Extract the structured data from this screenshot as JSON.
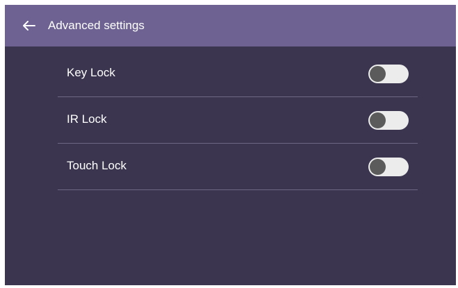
{
  "colors": {
    "header_bg": "#6d6291",
    "content_bg": "#3b3550",
    "divider": "#6e6884",
    "toggle_track": "#ececec",
    "toggle_knob": "#5b5b5b",
    "text": "#ffffff"
  },
  "header": {
    "back_icon": "arrow-left-icon",
    "title": "Advanced settings"
  },
  "settings": [
    {
      "label": "Key Lock",
      "enabled": false
    },
    {
      "label": "IR Lock",
      "enabled": false
    },
    {
      "label": "Touch Lock",
      "enabled": false
    }
  ]
}
